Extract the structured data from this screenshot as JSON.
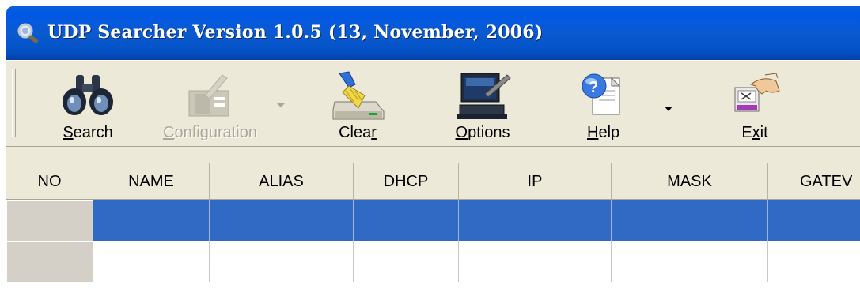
{
  "window": {
    "title": "UDP Searcher Version 1.0.5 (13, November, 2006)"
  },
  "toolbar": {
    "buttons": [
      {
        "id": "search",
        "label": "Search",
        "mnemonic_index": 0,
        "icon": "binoculars-icon",
        "enabled": true
      },
      {
        "id": "configuration",
        "label": "Configuration",
        "mnemonic_index": 0,
        "icon": "configuration-icon",
        "enabled": false,
        "has_dropdown": true
      },
      {
        "id": "clear",
        "label": "Clear",
        "mnemonic_index": 4,
        "icon": "broom-drive-icon",
        "enabled": true
      },
      {
        "id": "options",
        "label": "Options",
        "mnemonic_index": 0,
        "icon": "computer-options-icon",
        "enabled": true
      },
      {
        "id": "help",
        "label": "Help",
        "mnemonic_index": 0,
        "icon": "help-icon",
        "enabled": true,
        "has_dropdown": true
      },
      {
        "id": "exit",
        "label": "Exit",
        "mnemonic_index": 1,
        "icon": "exit-hand-icon",
        "enabled": true
      }
    ]
  },
  "grid": {
    "columns": [
      "NO",
      "NAME",
      "ALIAS",
      "DHCP",
      "IP",
      "MASK",
      "GATEV"
    ],
    "rows": [
      {
        "selected": true,
        "cells": [
          "",
          "",
          "",
          "",
          "",
          "",
          ""
        ]
      },
      {
        "selected": false,
        "cells": [
          "",
          "",
          "",
          "",
          "",
          "",
          ""
        ]
      }
    ]
  },
  "colors": {
    "titlebar": "#0058e6",
    "selection": "#316ac5",
    "toolbar_bg": "#ece9d8"
  }
}
